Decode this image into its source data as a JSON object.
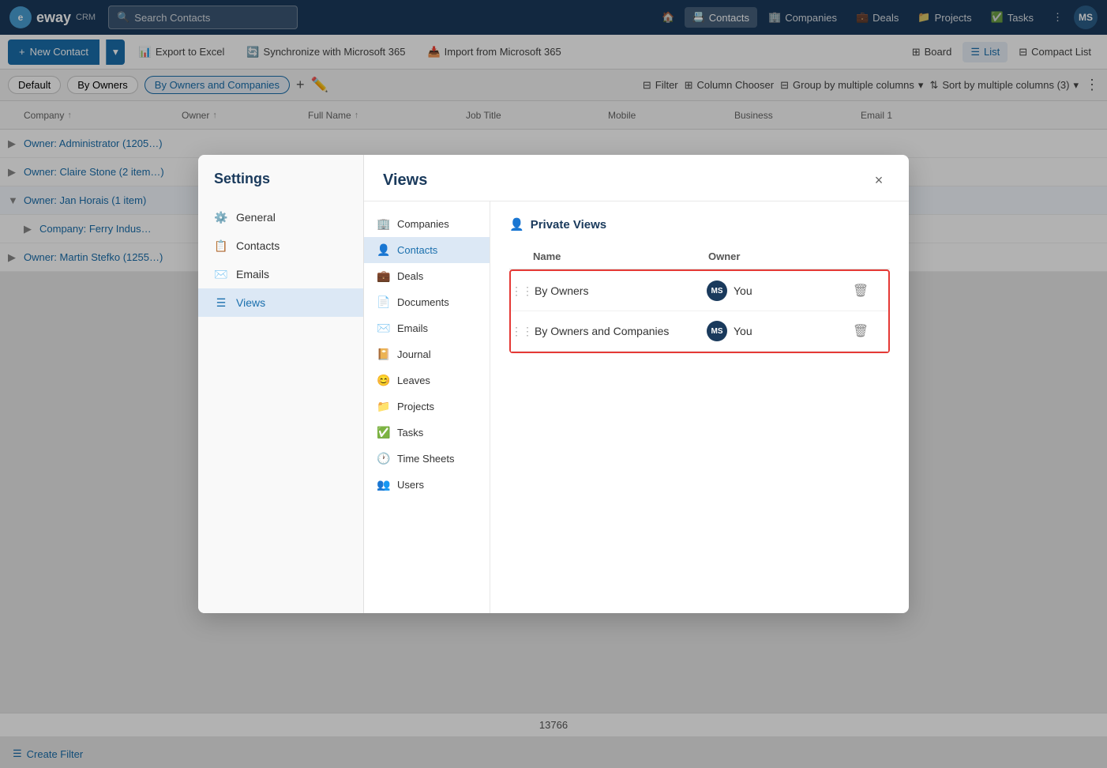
{
  "app": {
    "logo": "eway",
    "logo_icon": "e"
  },
  "topnav": {
    "search_placeholder": "Search Contacts",
    "home_icon": "🏠",
    "items": [
      {
        "label": "Contacts",
        "active": true
      },
      {
        "label": "Companies",
        "active": false
      },
      {
        "label": "Deals",
        "active": false
      },
      {
        "label": "Projects",
        "active": false
      },
      {
        "label": "Tasks",
        "active": false
      }
    ],
    "more_icon": "⋮",
    "avatar_initials": "MS"
  },
  "toolbar": {
    "new_contact_label": "New Contact",
    "export_label": "Export to Excel",
    "sync_label": "Synchronize with Microsoft 365",
    "import_label": "Import from Microsoft 365",
    "board_label": "Board",
    "list_label": "List",
    "compact_list_label": "Compact List"
  },
  "filterbar": {
    "tags": [
      "Default",
      "By Owners",
      "By Owners and Companies"
    ],
    "active_tag": "By Owners and Companies",
    "filter_label": "Filter",
    "column_chooser_label": "Column Chooser",
    "group_label": "Group by multiple columns",
    "sort_label": "Sort by multiple columns (3)"
  },
  "table": {
    "columns": [
      "Company",
      "Owner",
      "Full Name",
      "Job Title",
      "Mobile",
      "Business",
      "Email 1"
    ],
    "rows": [
      {
        "expand": true,
        "company": "Owner: Administrator (1205…)",
        "owner": "",
        "fullname": "",
        "jobtitle": "",
        "mobile": "",
        "business": "",
        "email": ""
      },
      {
        "expand": false,
        "company": "Owner: Claire Stone (2 item…)",
        "owner": "",
        "fullname": "",
        "jobtitle": "",
        "mobile": "",
        "business": "",
        "email": ""
      },
      {
        "expand": true,
        "company": "Owner: Jan Horais (1 item)",
        "owner": "",
        "fullname": "",
        "jobtitle": "",
        "mobile": "",
        "business": "",
        "email": ""
      },
      {
        "expand": false,
        "company": "Company: Ferry Indus…",
        "owner": "",
        "fullname": "",
        "jobtitle": "",
        "mobile": "",
        "business": "",
        "email": ""
      },
      {
        "expand": false,
        "company": "Owner: Martin Stefko (1255…)",
        "owner": "",
        "fullname": "",
        "jobtitle": "",
        "mobile": "",
        "business": "",
        "email": ""
      }
    ]
  },
  "count": "13766",
  "create_filter_label": "Create Filter",
  "modal": {
    "settings_title": "Settings",
    "settings_items": [
      {
        "label": "General",
        "icon": "⚙️",
        "active": false
      },
      {
        "label": "Contacts",
        "icon": "📋",
        "active": false
      },
      {
        "label": "Emails",
        "icon": "✉️",
        "active": false
      },
      {
        "label": "Views",
        "icon": "☰",
        "active": true
      }
    ],
    "views_title": "Views",
    "close_btn": "×",
    "nav_items": [
      {
        "label": "Companies",
        "icon": "🏢",
        "active": false
      },
      {
        "label": "Contacts",
        "icon": "👤",
        "active": true
      },
      {
        "label": "Deals",
        "icon": "💼",
        "active": false
      },
      {
        "label": "Documents",
        "icon": "📄",
        "active": false
      },
      {
        "label": "Emails",
        "icon": "✉️",
        "active": false
      },
      {
        "label": "Journal",
        "icon": "📔",
        "active": false
      },
      {
        "label": "Leaves",
        "icon": "😊",
        "active": false
      },
      {
        "label": "Projects",
        "icon": "📁",
        "active": false
      },
      {
        "label": "Tasks",
        "icon": "✅",
        "active": false
      },
      {
        "label": "Time Sheets",
        "icon": "🕐",
        "active": false
      },
      {
        "label": "Users",
        "icon": "👥",
        "active": false
      }
    ],
    "private_views_label": "Private Views",
    "private_views_icon": "👤",
    "col_name": "Name",
    "col_owner": "Owner",
    "views": [
      {
        "name": "By Owners",
        "owner_initials": "MS",
        "owner_name": "You"
      },
      {
        "name": "By Owners and Companies",
        "owner_initials": "MS",
        "owner_name": "You"
      }
    ]
  }
}
